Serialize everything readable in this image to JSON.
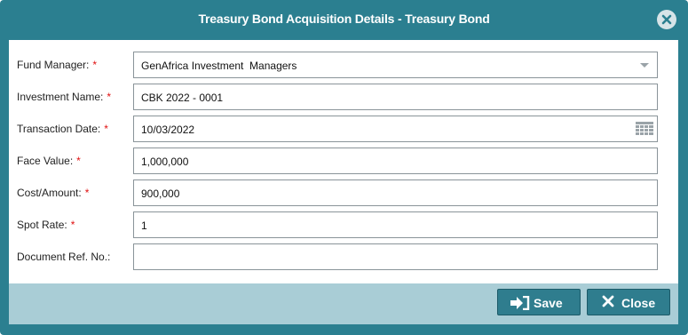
{
  "dialog": {
    "title": "Treasury Bond Acquisition Details - Treasury Bond"
  },
  "form": {
    "fields": [
      {
        "label": "Fund Manager:",
        "required": true,
        "value": "GenAfrica Investment  Managers",
        "type": "select"
      },
      {
        "label": "Investment Name:",
        "required": true,
        "value": "CBK 2022 - 0001",
        "type": "text"
      },
      {
        "label": "Transaction Date:",
        "required": true,
        "value": "10/03/2022",
        "type": "date"
      },
      {
        "label": "Face Value:",
        "required": true,
        "value": "1,000,000",
        "type": "text"
      },
      {
        "label": "Cost/Amount:",
        "required": true,
        "value": "900,000",
        "type": "text"
      },
      {
        "label": "Spot Rate:",
        "required": true,
        "value": "1",
        "type": "text"
      },
      {
        "label": "Document Ref. No.:",
        "required": false,
        "value": "",
        "type": "text"
      }
    ],
    "required_mark": "*"
  },
  "footer": {
    "save_label": "Save",
    "close_label": "Close"
  },
  "icons": {
    "close": "close-circle-icon",
    "calendar": "calendar-icon",
    "save": "sign-in-arrow-icon",
    "cancel": "x-icon",
    "dropdown": "chevron-down-icon"
  },
  "colors": {
    "titlebar": "#2b7f90",
    "footer": "#a9cdd6",
    "button": "#2f7d8e",
    "required": "#e01010"
  }
}
